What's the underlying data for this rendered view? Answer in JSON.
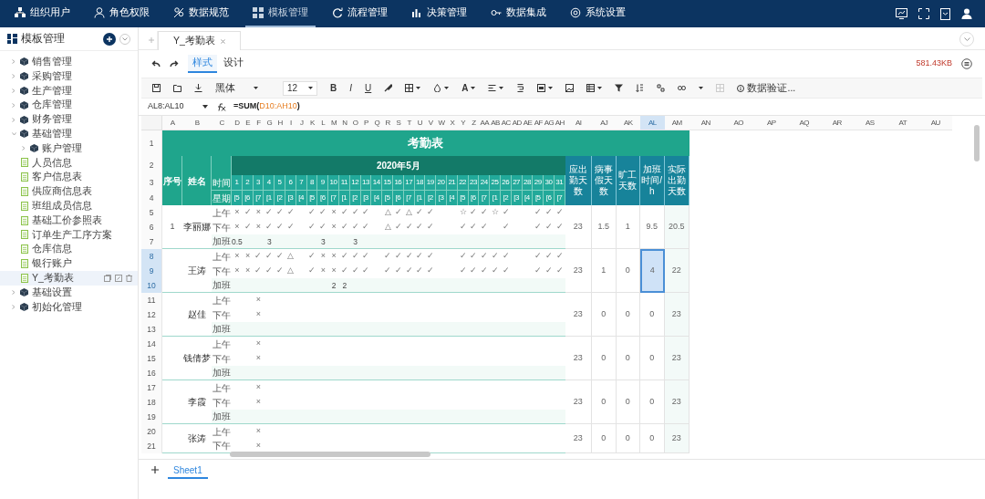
{
  "top_nav": [
    {
      "label": "组织用户",
      "selected": false
    },
    {
      "label": "角色权限",
      "selected": false
    },
    {
      "label": "数据规范",
      "selected": false
    },
    {
      "label": "模板管理",
      "selected": true
    },
    {
      "label": "流程管理",
      "selected": false
    },
    {
      "label": "决策管理",
      "selected": false
    },
    {
      "label": "数据集成",
      "selected": false
    },
    {
      "label": "系统设置",
      "selected": false
    }
  ],
  "sidebar": {
    "title": "模板管理",
    "tree": [
      {
        "label": "销售管理",
        "kind": "folder",
        "expanded": false,
        "selected": false
      },
      {
        "label": "采购管理",
        "kind": "folder",
        "expanded": false,
        "selected": false
      },
      {
        "label": "生产管理",
        "kind": "folder",
        "expanded": false,
        "selected": false
      },
      {
        "label": "仓库管理",
        "kind": "folder",
        "expanded": false,
        "selected": false
      },
      {
        "label": "财务管理",
        "kind": "folder",
        "expanded": false,
        "selected": false
      },
      {
        "label": "基础管理",
        "kind": "folder",
        "expanded": true,
        "selected": false,
        "children": [
          {
            "label": "账户管理",
            "kind": "folder",
            "expanded": false,
            "selected": false
          },
          {
            "label": "人员信息",
            "kind": "sheet",
            "selected": false
          },
          {
            "label": "客户信息表",
            "kind": "sheet",
            "selected": false
          },
          {
            "label": "供应商信息表",
            "kind": "sheet",
            "selected": false
          },
          {
            "label": "班组成员信息",
            "kind": "sheet",
            "selected": false
          },
          {
            "label": "基础工价参照表",
            "kind": "sheet",
            "selected": false
          },
          {
            "label": "订单生产工序方案",
            "kind": "sheet",
            "selected": false
          },
          {
            "label": "仓库信息",
            "kind": "sheet",
            "selected": false
          },
          {
            "label": "银行账户",
            "kind": "sheet",
            "selected": false
          },
          {
            "label": "Y_考勤表",
            "kind": "sheet",
            "selected": true
          }
        ]
      },
      {
        "label": "基础设置",
        "kind": "folder",
        "expanded": false,
        "selected": false
      },
      {
        "label": "初始化管理",
        "kind": "folder",
        "expanded": false,
        "selected": false
      }
    ]
  },
  "doc_tabs": [
    {
      "label": "Y_考勤表",
      "selected": true
    }
  ],
  "mode_tabs": [
    {
      "label": "样式",
      "selected": true
    },
    {
      "label": "设计",
      "selected": false
    }
  ],
  "file_size": "581.43KB",
  "toolbar": {
    "font": "黑体",
    "font_size": "12",
    "bold": "B",
    "italic": "I",
    "underline": "U",
    "font_color": "A",
    "validation": "数据验证..."
  },
  "formula_bar": {
    "cell_ref": "AL8:AL10",
    "formula": [
      {
        "text": "=SUM(",
        "kind": "function"
      },
      {
        "text": "D10:AH10",
        "kind": "reference"
      },
      {
        "text": ")",
        "kind": "function"
      }
    ]
  },
  "sheet": {
    "columns": [
      {
        "label": "A",
        "selected": false
      },
      {
        "label": "B",
        "selected": false
      },
      {
        "label": "C",
        "selected": false
      },
      {
        "label": "D",
        "selected": false
      },
      {
        "label": "E",
        "selected": false
      },
      {
        "label": "F",
        "selected": false
      },
      {
        "label": "G",
        "selected": false
      },
      {
        "label": "H",
        "selected": false
      },
      {
        "label": "I",
        "selected": false
      },
      {
        "label": "J",
        "selected": false
      },
      {
        "label": "K",
        "selected": false
      },
      {
        "label": "L",
        "selected": false
      },
      {
        "label": "M",
        "selected": false
      },
      {
        "label": "N",
        "selected": false
      },
      {
        "label": "O",
        "selected": false
      },
      {
        "label": "P",
        "selected": false
      },
      {
        "label": "Q",
        "selected": false
      },
      {
        "label": "R",
        "selected": false
      },
      {
        "label": "S",
        "selected": false
      },
      {
        "label": "T",
        "selected": false
      },
      {
        "label": "U",
        "selected": false
      },
      {
        "label": "V",
        "selected": false
      },
      {
        "label": "W",
        "selected": false
      },
      {
        "label": "X",
        "selected": false
      },
      {
        "label": "Y",
        "selected": false
      },
      {
        "label": "Z",
        "selected": false
      },
      {
        "label": "AA",
        "selected": false
      },
      {
        "label": "AB",
        "selected": false
      },
      {
        "label": "AC",
        "selected": false
      },
      {
        "label": "AD",
        "selected": false
      },
      {
        "label": "AE",
        "selected": false
      },
      {
        "label": "AF",
        "selected": false
      },
      {
        "label": "AG",
        "selected": false
      },
      {
        "label": "AH",
        "selected": false
      },
      {
        "label": "AI",
        "selected": false
      },
      {
        "label": "AJ",
        "selected": false
      },
      {
        "label": "AK",
        "selected": false
      },
      {
        "label": "AL",
        "selected": true
      },
      {
        "label": "AM",
        "selected": false
      },
      {
        "label": "AN",
        "selected": false
      },
      {
        "label": "AO",
        "selected": false
      },
      {
        "label": "AP",
        "selected": false
      },
      {
        "label": "AQ",
        "selected": false
      },
      {
        "label": "AR",
        "selected": false
      },
      {
        "label": "AS",
        "selected": false
      },
      {
        "label": "AT",
        "selected": false
      },
      {
        "label": "AU",
        "selected": false
      }
    ],
    "row_numbers": [
      {
        "label": "1",
        "selected": false
      },
      {
        "label": "2",
        "selected": false
      },
      {
        "label": "3",
        "selected": false
      },
      {
        "label": "4",
        "selected": false
      },
      {
        "label": "5",
        "selected": false
      },
      {
        "label": "6",
        "selected": false
      },
      {
        "label": "7",
        "selected": false
      },
      {
        "label": "8",
        "selected": true
      },
      {
        "label": "9",
        "selected": true
      },
      {
        "label": "10",
        "selected": true
      },
      {
        "label": "11",
        "selected": false
      },
      {
        "label": "12",
        "selected": false
      },
      {
        "label": "13",
        "selected": false
      },
      {
        "label": "14",
        "selected": false
      },
      {
        "label": "15",
        "selected": false
      },
      {
        "label": "16",
        "selected": false
      },
      {
        "label": "17",
        "selected": false
      },
      {
        "label": "18",
        "selected": false
      },
      {
        "label": "19",
        "selected": false
      },
      {
        "label": "20",
        "selected": false
      },
      {
        "label": "21",
        "selected": false
      }
    ],
    "title": "考勤表",
    "month": "2020年5月",
    "seq_header": "序号",
    "name_header": "姓名",
    "time_header": "时间",
    "week_header": "星期",
    "summary_headers": [
      "应出勤天数",
      "病事假天数",
      "旷工天数",
      "加班时间/h",
      "实际出勤天数"
    ],
    "days": [
      "1",
      "2",
      "3",
      "4",
      "5",
      "6",
      "7",
      "8",
      "9",
      "10",
      "11",
      "12",
      "13",
      "14",
      "15",
      "16",
      "17",
      "18",
      "19",
      "20",
      "21",
      "22",
      "23",
      "24",
      "25",
      "26",
      "27",
      "28",
      "29",
      "30",
      "31"
    ],
    "weekdays": [
      "[5",
      "[6",
      "[7",
      "[1",
      "[2",
      "[3",
      "[4",
      "[5",
      "[6",
      "[7",
      "[1",
      "[2",
      "[3",
      "[4",
      "[5",
      "[6",
      "[7",
      "[1",
      "[2",
      "[3",
      "[4",
      "[5",
      "[6",
      "[7",
      "[1",
      "[2",
      "[3",
      "[4",
      "[5",
      "[6",
      "[7"
    ],
    "people": [
      {
        "seq": "1",
        "name": "李丽娜",
        "rows": [
          {
            "label": "上午",
            "kind": "marks",
            "cells": [
              "×",
              "✓",
              "×",
              "✓",
              "✓",
              "✓",
              null,
              "✓",
              "✓",
              "×",
              "✓",
              "✓",
              "✓",
              null,
              "△",
              "✓",
              "△",
              "✓",
              "✓",
              null,
              null,
              "☆",
              "✓",
              "✓",
              "☆",
              "✓",
              null,
              null,
              "✓",
              "✓",
              "✓"
            ]
          },
          {
            "label": "下午",
            "kind": "marks",
            "cells": [
              "×",
              "✓",
              "×",
              "✓",
              "✓",
              "✓",
              null,
              "✓",
              "✓",
              "×",
              "✓",
              "✓",
              "✓",
              null,
              "△",
              "✓",
              "✓",
              "✓",
              "✓",
              null,
              null,
              "✓",
              "✓",
              "✓",
              null,
              "✓",
              null,
              null,
              "✓",
              "✓",
              "✓"
            ]
          },
          {
            "label": "加班",
            "kind": "overtime",
            "cells": [
              "0.5",
              null,
              null,
              "3",
              null,
              null,
              null,
              null,
              "3",
              null,
              null,
              "3",
              null,
              null,
              null,
              null,
              null,
              null,
              null,
              null,
              null,
              null,
              null,
              null,
              null,
              null,
              null,
              null,
              null,
              null,
              null
            ]
          }
        ],
        "totals": [
          {
            "value": "23",
            "selected": false
          },
          {
            "value": "1.5",
            "selected": false
          },
          {
            "value": "1",
            "selected": false
          },
          {
            "value": "9.5",
            "selected": false
          },
          {
            "value": "20.5",
            "selected": false
          }
        ]
      },
      {
        "name": "王涛",
        "rows": [
          {
            "label": "上午",
            "kind": "marks",
            "cells": [
              "×",
              "×",
              "✓",
              "✓",
              "✓",
              "△",
              null,
              "✓",
              "×",
              "×",
              "✓",
              "✓",
              "✓",
              null,
              "✓",
              "✓",
              "✓",
              "✓",
              "✓",
              null,
              null,
              "✓",
              "✓",
              "✓",
              "✓",
              "✓",
              null,
              null,
              "✓",
              "✓",
              "✓"
            ]
          },
          {
            "label": "下午",
            "kind": "marks",
            "cells": [
              "×",
              "×",
              "✓",
              "✓",
              "✓",
              "△",
              null,
              "✓",
              "×",
              "×",
              "✓",
              "✓",
              "✓",
              null,
              "✓",
              "✓",
              "✓",
              "✓",
              "✓",
              null,
              null,
              "✓",
              "✓",
              "✓",
              "✓",
              "✓",
              null,
              null,
              "✓",
              "✓",
              "✓"
            ]
          },
          {
            "label": "加班",
            "kind": "overtime",
            "cells": [
              null,
              null,
              null,
              null,
              null,
              null,
              null,
              null,
              null,
              "2",
              "2",
              null,
              null,
              null,
              null,
              null,
              null,
              null,
              null,
              null,
              null,
              null,
              null,
              null,
              null,
              null,
              null,
              null,
              null,
              null,
              null
            ]
          }
        ],
        "totals": [
          {
            "value": "23",
            "selected": false
          },
          {
            "value": "1",
            "selected": false
          },
          {
            "value": "0",
            "selected": false
          },
          {
            "value": "4",
            "selected": true
          },
          {
            "value": "22",
            "selected": false
          }
        ]
      },
      {
        "name": "赵佳",
        "rows": [
          {
            "label": "上午",
            "kind": "marks",
            "cells": [
              null,
              null,
              "×",
              null,
              null,
              null,
              null,
              null,
              null,
              null,
              null,
              null,
              null,
              null,
              null,
              null,
              null,
              null,
              null,
              null,
              null,
              null,
              null,
              null,
              null,
              null,
              null,
              null,
              null,
              null,
              null
            ]
          },
          {
            "label": "下午",
            "kind": "marks",
            "cells": [
              null,
              null,
              "×",
              null,
              null,
              null,
              null,
              null,
              null,
              null,
              null,
              null,
              null,
              null,
              null,
              null,
              null,
              null,
              null,
              null,
              null,
              null,
              null,
              null,
              null,
              null,
              null,
              null,
              null,
              null,
              null
            ]
          },
          {
            "label": "加班",
            "kind": "overtime",
            "cells": [
              null,
              null,
              null,
              null,
              null,
              null,
              null,
              null,
              null,
              null,
              null,
              null,
              null,
              null,
              null,
              null,
              null,
              null,
              null,
              null,
              null,
              null,
              null,
              null,
              null,
              null,
              null,
              null,
              null,
              null,
              null
            ]
          }
        ],
        "totals": [
          {
            "value": "23",
            "selected": false
          },
          {
            "value": "0",
            "selected": false
          },
          {
            "value": "0",
            "selected": false
          },
          {
            "value": "0",
            "selected": false
          },
          {
            "value": "23",
            "selected": false
          }
        ]
      },
      {
        "name": "钱倩梦",
        "rows": [
          {
            "label": "上午",
            "kind": "marks",
            "cells": [
              null,
              null,
              "×",
              null,
              null,
              null,
              null,
              null,
              null,
              null,
              null,
              null,
              null,
              null,
              null,
              null,
              null,
              null,
              null,
              null,
              null,
              null,
              null,
              null,
              null,
              null,
              null,
              null,
              null,
              null,
              null
            ]
          },
          {
            "label": "下午",
            "kind": "marks",
            "cells": [
              null,
              null,
              "×",
              null,
              null,
              null,
              null,
              null,
              null,
              null,
              null,
              null,
              null,
              null,
              null,
              null,
              null,
              null,
              null,
              null,
              null,
              null,
              null,
              null,
              null,
              null,
              null,
              null,
              null,
              null,
              null
            ]
          },
          {
            "label": "加班",
            "kind": "overtime",
            "cells": [
              null,
              null,
              null,
              null,
              null,
              null,
              null,
              null,
              null,
              null,
              null,
              null,
              null,
              null,
              null,
              null,
              null,
              null,
              null,
              null,
              null,
              null,
              null,
              null,
              null,
              null,
              null,
              null,
              null,
              null,
              null
            ]
          }
        ],
        "totals": [
          {
            "value": "23",
            "selected": false
          },
          {
            "value": "0",
            "selected": false
          },
          {
            "value": "0",
            "selected": false
          },
          {
            "value": "0",
            "selected": false
          },
          {
            "value": "23",
            "selected": false
          }
        ]
      },
      {
        "name": "李霞",
        "rows": [
          {
            "label": "上午",
            "kind": "marks",
            "cells": [
              null,
              null,
              "×",
              null,
              null,
              null,
              null,
              null,
              null,
              null,
              null,
              null,
              null,
              null,
              null,
              null,
              null,
              null,
              null,
              null,
              null,
              null,
              null,
              null,
              null,
              null,
              null,
              null,
              null,
              null,
              null
            ]
          },
          {
            "label": "下午",
            "kind": "marks",
            "cells": [
              null,
              null,
              "×",
              null,
              null,
              null,
              null,
              null,
              null,
              null,
              null,
              null,
              null,
              null,
              null,
              null,
              null,
              null,
              null,
              null,
              null,
              null,
              null,
              null,
              null,
              null,
              null,
              null,
              null,
              null,
              null
            ]
          },
          {
            "label": "加班",
            "kind": "overtime",
            "cells": [
              null,
              null,
              null,
              null,
              null,
              null,
              null,
              null,
              null,
              null,
              null,
              null,
              null,
              null,
              null,
              null,
              null,
              null,
              null,
              null,
              null,
              null,
              null,
              null,
              null,
              null,
              null,
              null,
              null,
              null,
              null
            ]
          }
        ],
        "totals": [
          {
            "value": "23",
            "selected": false
          },
          {
            "value": "0",
            "selected": false
          },
          {
            "value": "0",
            "selected": false
          },
          {
            "value": "0",
            "selected": false
          },
          {
            "value": "23",
            "selected": false
          }
        ]
      },
      {
        "name": "张涛",
        "rows": [
          {
            "label": "上午",
            "kind": "marks",
            "cells": [
              null,
              null,
              "×",
              null,
              null,
              null,
              null,
              null,
              null,
              null,
              null,
              null,
              null,
              null,
              null,
              null,
              null,
              null,
              null,
              null,
              null,
              null,
              null,
              null,
              null,
              null,
              null,
              null,
              null,
              null,
              null
            ]
          },
          {
            "label": "下午",
            "kind": "marks",
            "cells": [
              null,
              null,
              "×",
              null,
              null,
              null,
              null,
              null,
              null,
              null,
              null,
              null,
              null,
              null,
              null,
              null,
              null,
              null,
              null,
              null,
              null,
              null,
              null,
              null,
              null,
              null,
              null,
              null,
              null,
              null,
              null
            ]
          }
        ],
        "totals": [
          {
            "value": "23",
            "selected": false
          },
          {
            "value": "0",
            "selected": false
          },
          {
            "value": "0",
            "selected": false
          },
          {
            "value": "0",
            "selected": false
          },
          {
            "value": "23",
            "selected": false
          }
        ]
      }
    ]
  },
  "sheet_tabs": [
    {
      "label": "Sheet1",
      "selected": true
    }
  ]
}
